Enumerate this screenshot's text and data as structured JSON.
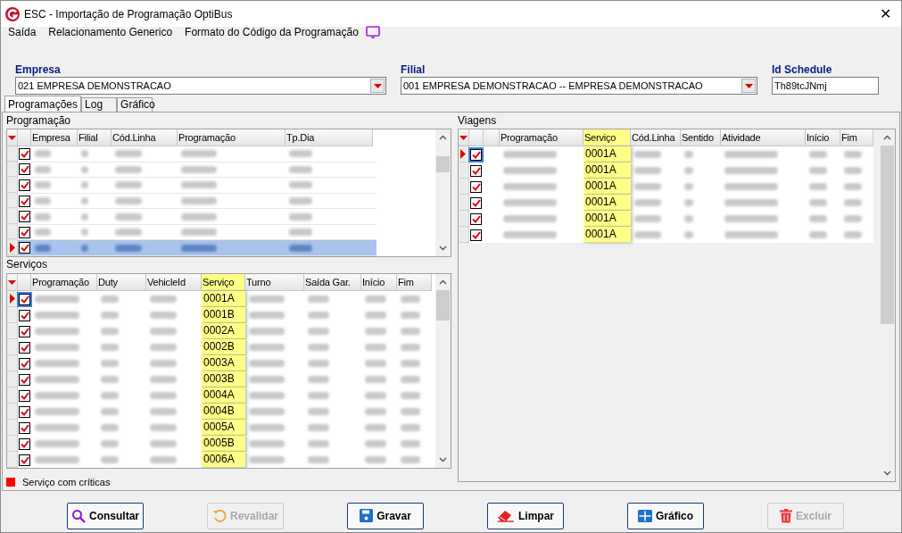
{
  "window": {
    "title": "ESC - Importação de Programação OptiBus",
    "close": "✕"
  },
  "menu": [
    {
      "label": "Saída"
    },
    {
      "label": "Relacionamento Generico"
    },
    {
      "label": "Formato do Código da Programação"
    }
  ],
  "filters": {
    "empresa": {
      "label": "Empresa",
      "value": "021 EMPRESA DEMONSTRACAO"
    },
    "filial": {
      "label": "Filial",
      "value": "001 EMPRESA DEMONSTRACAO -- EMPRESA DEMONSTRACAO"
    },
    "id_schedule": {
      "label": "Id Schedule",
      "value": "Th89tcJNmj"
    }
  },
  "tabs": [
    {
      "label": "Programações",
      "selected": true
    },
    {
      "label": "Log",
      "selected": false
    },
    {
      "label": "Gráfico",
      "selected": false
    }
  ],
  "programacao": {
    "title": "Programação",
    "columns": [
      "Empresa",
      "Filial",
      "Cód.Linha",
      "Programação",
      "Tp.Dia"
    ],
    "rows": [
      {
        "checked": true,
        "current": false,
        "selected": false
      },
      {
        "checked": true,
        "current": false,
        "selected": false
      },
      {
        "checked": true,
        "current": false,
        "selected": false
      },
      {
        "checked": true,
        "current": false,
        "selected": false
      },
      {
        "checked": true,
        "current": false,
        "selected": false
      },
      {
        "checked": true,
        "current": false,
        "selected": false
      },
      {
        "checked": true,
        "current": true,
        "selected": true
      }
    ]
  },
  "servicos": {
    "title": "Serviços",
    "columns": [
      "Programação",
      "Duty",
      "VehicleId",
      "Serviço",
      "Turno",
      "Saída Gar.",
      "Início",
      "Fim"
    ],
    "rows": [
      {
        "checked": true,
        "current": true,
        "servico": "0001A"
      },
      {
        "checked": true,
        "current": false,
        "servico": "0001B"
      },
      {
        "checked": true,
        "current": false,
        "servico": "0002A"
      },
      {
        "checked": true,
        "current": false,
        "servico": "0002B"
      },
      {
        "checked": true,
        "current": false,
        "servico": "0003A"
      },
      {
        "checked": true,
        "current": false,
        "servico": "0003B"
      },
      {
        "checked": true,
        "current": false,
        "servico": "0004A"
      },
      {
        "checked": true,
        "current": false,
        "servico": "0004B"
      },
      {
        "checked": true,
        "current": false,
        "servico": "0005A"
      },
      {
        "checked": true,
        "current": false,
        "servico": "0005B"
      },
      {
        "checked": true,
        "current": false,
        "servico": "0006A"
      }
    ]
  },
  "viagens": {
    "title": "Viagens",
    "columns": [
      "Programação",
      "Serviço",
      "Cód.Linha",
      "Sentido",
      "Atividade",
      "Início",
      "Fim"
    ],
    "rows": [
      {
        "checked": true,
        "current": true,
        "servico": "0001A"
      },
      {
        "checked": true,
        "current": false,
        "servico": "0001A"
      },
      {
        "checked": true,
        "current": false,
        "servico": "0001A"
      },
      {
        "checked": true,
        "current": false,
        "servico": "0001A"
      },
      {
        "checked": true,
        "current": false,
        "servico": "0001A"
      },
      {
        "checked": true,
        "current": false,
        "servico": "0001A"
      }
    ]
  },
  "legend": {
    "label": "Serviço com críticas",
    "color": "#ff0000"
  },
  "buttons": [
    {
      "label": "Consultar",
      "kind": "search",
      "disabled": false
    },
    {
      "label": "Revalidar",
      "kind": "undo",
      "disabled": true
    },
    {
      "label": "Gravar",
      "kind": "save",
      "disabled": false
    },
    {
      "label": "Limpar",
      "kind": "eraser",
      "disabled": false
    },
    {
      "label": "Gráfico",
      "kind": "grid",
      "disabled": false
    },
    {
      "label": "Excluir",
      "kind": "trash",
      "disabled": true
    }
  ]
}
